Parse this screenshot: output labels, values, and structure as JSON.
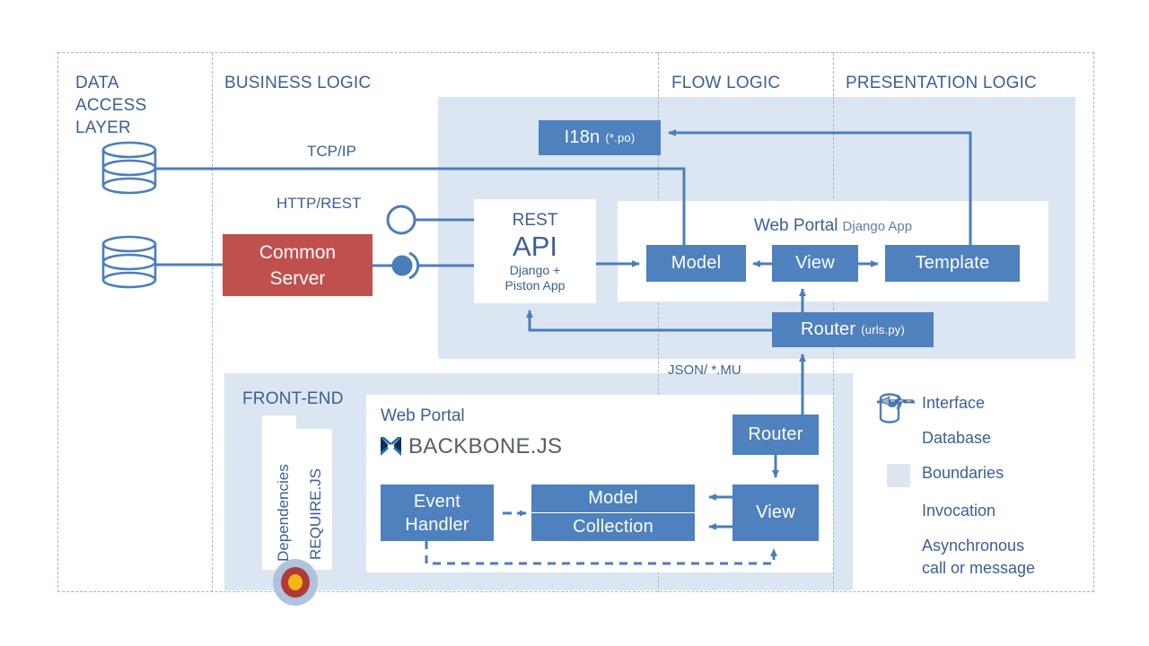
{
  "diagram": {
    "title": "Web application architecture layers diagram",
    "columns": [
      {
        "id": "data-access-layer",
        "label": "DATA\nACCESS\nLAYER"
      },
      {
        "id": "business-logic",
        "label": "BUSINESS LOGIC"
      },
      {
        "id": "flow-logic",
        "label": "FLOW LOGIC"
      },
      {
        "id": "presentation-logic",
        "label": "PRESENTATION LOGIC"
      }
    ],
    "column_labels": {
      "data_access_line1": "DATA",
      "data_access_line2": "ACCESS",
      "data_access_line3": "LAYER",
      "business": "BUSINESS LOGIC",
      "flow": "FLOW LOGIC",
      "presentation": "PRESENTATION LOGIC"
    },
    "connector_labels": {
      "tcpip": "TCP/IP",
      "http_rest": "HTTP/REST",
      "json_mu": "JSON/ *.MU"
    },
    "nodes": {
      "common_server": "Common\nServer",
      "common_server_line1": "Common",
      "common_server_line2": "Server",
      "rest_api_top": "REST",
      "rest_api_main": "API",
      "rest_api_sub1": "Django +",
      "rest_api_sub2": "Piston App",
      "i18n": "I18n",
      "i18n_sub": "(*.po)",
      "backend_portal_title": "Web Portal",
      "backend_portal_sub": "Django App",
      "model": "Model",
      "view": "View",
      "template": "Template",
      "router_backend": "Router",
      "router_backend_sub": "(urls.py)",
      "frontend_section": "FRONT-END",
      "frontend_portal_title": "Web Portal",
      "backbone_label": "BACKBONE.JS",
      "dependencies": "Dependencies",
      "requirejs": "REQUIRE.JS",
      "event_handler_line1": "Event",
      "event_handler_line2": "Handler",
      "fe_model": "Model",
      "fe_collection": "Collection",
      "fe_view": "View",
      "fe_router": "Router"
    },
    "legend": {
      "items": [
        {
          "icon": "interface-icon",
          "label": "Interface"
        },
        {
          "icon": "database-icon",
          "label": "Database"
        },
        {
          "icon": "boundaries-icon",
          "label": "Boundaries"
        },
        {
          "icon": "invocation-arrow-icon",
          "label": "Invocation"
        },
        {
          "icon": "async-arrow-icon",
          "label": "Asynchronous\ncall or message"
        }
      ],
      "async_line1": "Asynchronous",
      "async_line2": "call or message"
    },
    "colors": {
      "accent_blue": "#4e81bd",
      "line_blue": "#4a7ebb",
      "text_blue": "#3b6094",
      "red": "#c0504d",
      "boundary": "#dce6f2",
      "dashed_border": "#9fb6d4",
      "requirejs_outer": "#aec3de",
      "requirejs_mid": "#b03a36",
      "requirejs_inner": "#f5b516",
      "backbone_logo": "#0f2c4d"
    }
  }
}
